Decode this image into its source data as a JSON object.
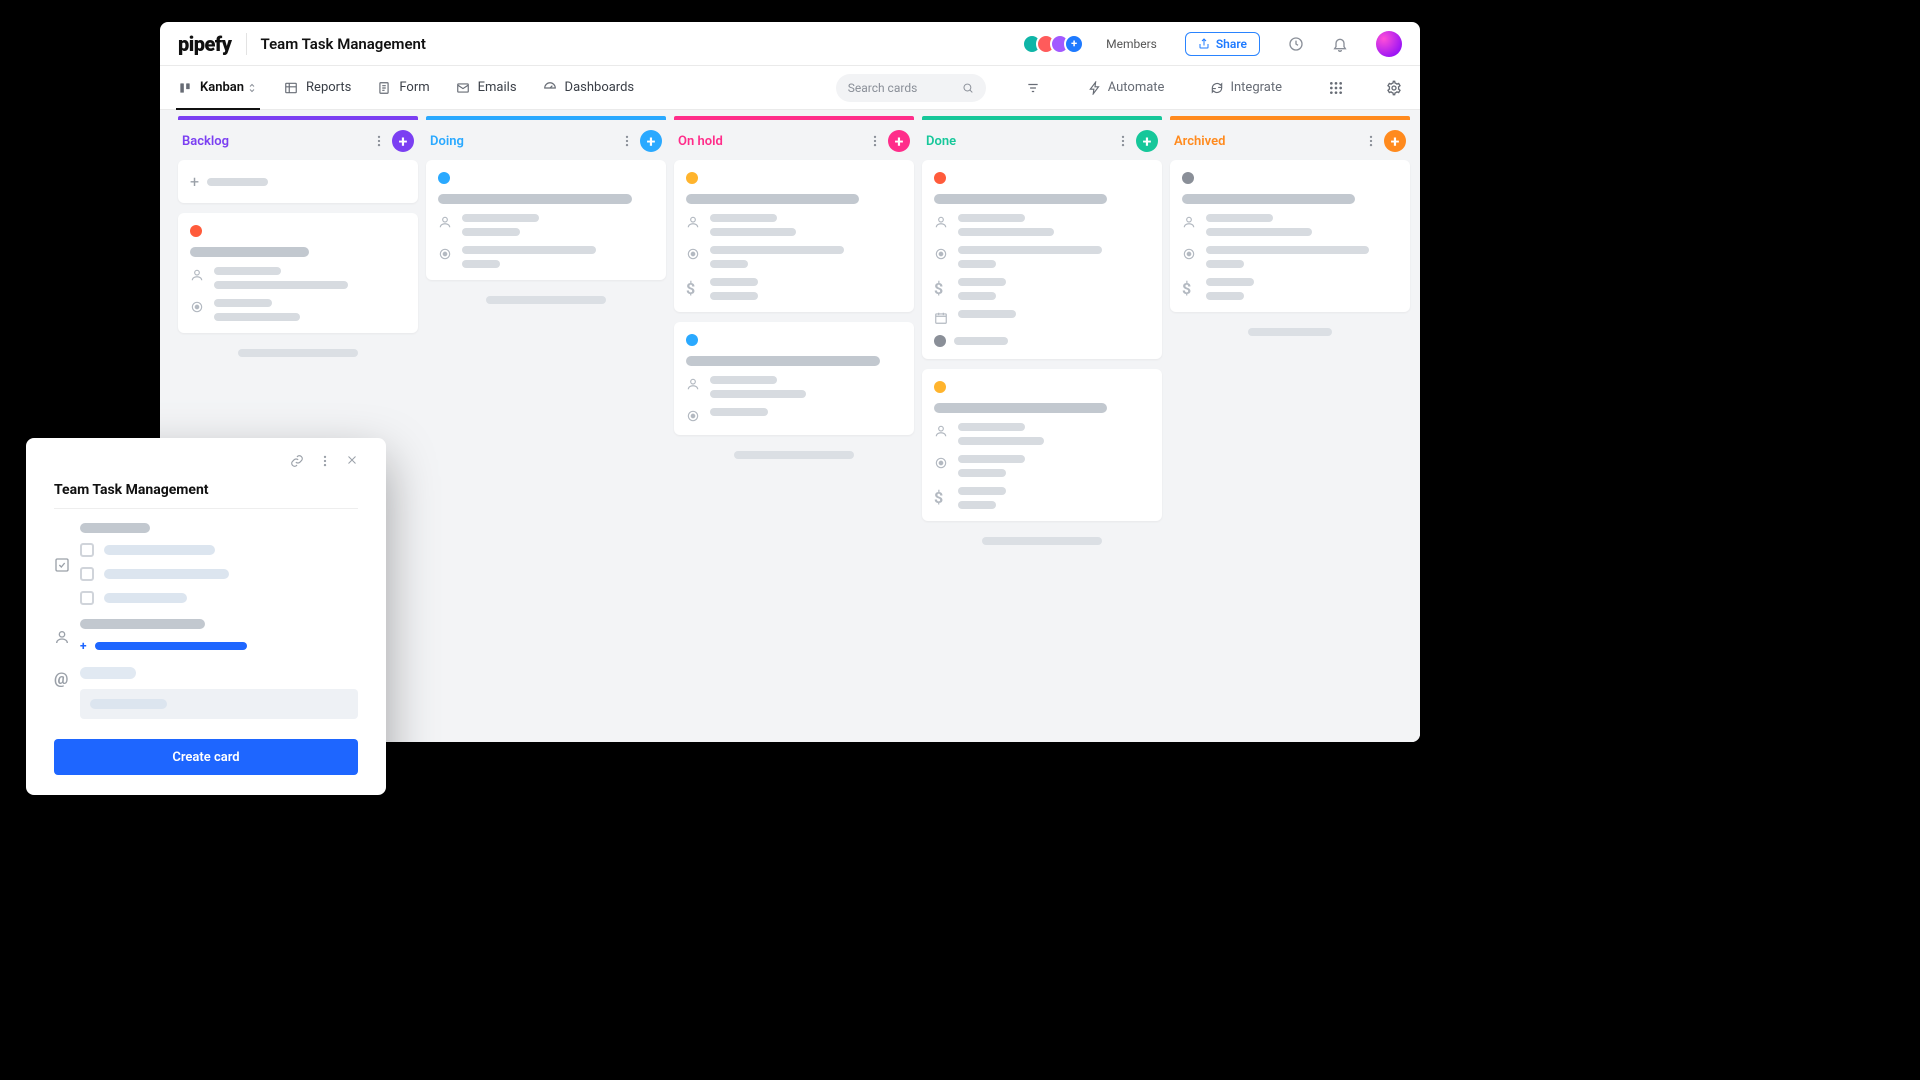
{
  "app_name": "pipefy",
  "pipe_title": "Team Task Management",
  "topbar": {
    "members_label": "Members",
    "share_label": "Share",
    "avatar_extra": "+"
  },
  "viewbar": {
    "tabs": {
      "kanban": "Kanban",
      "reports": "Reports",
      "form": "Form",
      "emails": "Emails",
      "dashboards": "Dashboards"
    },
    "search_placeholder": "Search cards",
    "automate": "Automate",
    "integrate": "Integrate"
  },
  "columns": {
    "backlog": "Backlog",
    "doing": "Doing",
    "onhold": "On hold",
    "done": "Done",
    "archived": "Archived"
  },
  "modal": {
    "title": "Team Task Management",
    "create_btn": "Create card"
  }
}
